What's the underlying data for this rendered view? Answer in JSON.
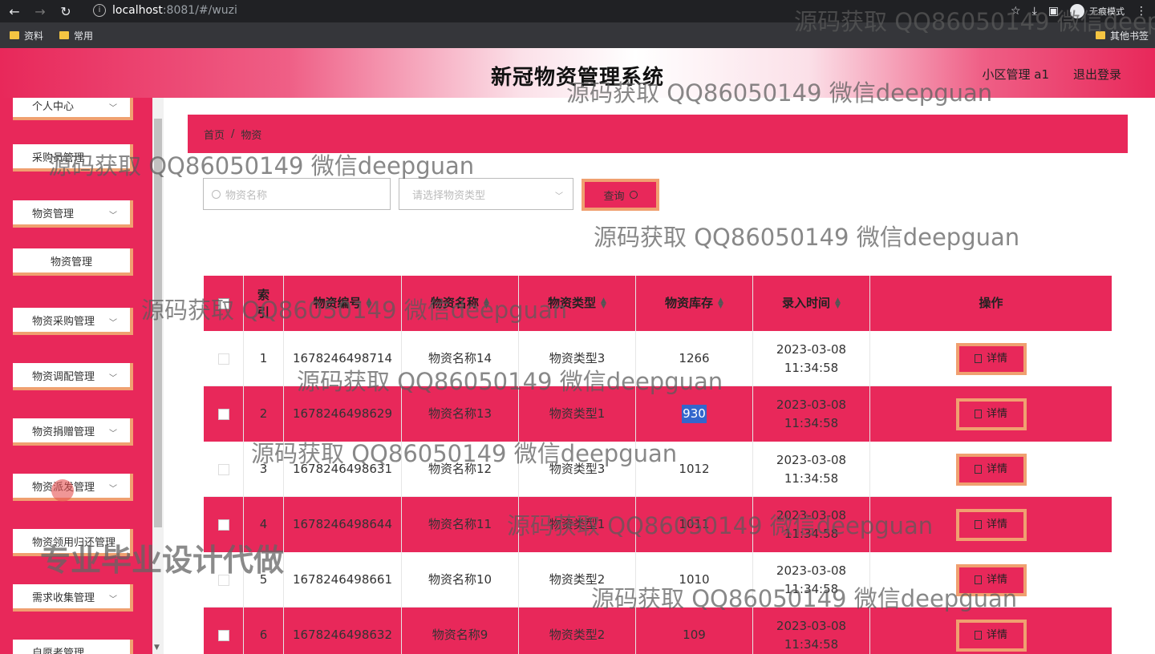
{
  "browser": {
    "url_host": "localhost",
    "url_port_path": ":8081/#/wuzi",
    "incognito_label": "无痕模式",
    "bookmarks": [
      "资料",
      "常用"
    ],
    "other_bookmarks": "其他书签"
  },
  "header": {
    "title": "新冠物资管理系统",
    "user": "小区管理 a1",
    "logout": "退出登录"
  },
  "sidebar": {
    "items": [
      {
        "label": "个人中心"
      },
      {
        "label": "采购员管理"
      },
      {
        "label": "物资管理"
      },
      {
        "label": "物资管理"
      },
      {
        "label": "物资采购管理"
      },
      {
        "label": "物资调配管理"
      },
      {
        "label": "物资捐赠管理"
      },
      {
        "label": "物资派发管理"
      },
      {
        "label": "物资领用归还管理"
      },
      {
        "label": "需求收集管理"
      },
      {
        "label": "自愿者管理"
      }
    ]
  },
  "breadcrumb": {
    "home": "首页",
    "sep": "/",
    "current": "物资"
  },
  "filters": {
    "name_placeholder": "物资名称",
    "type_placeholder": "请选择物资类型",
    "query_label": "查询"
  },
  "table": {
    "headers": [
      "索引",
      "物资编号",
      "物资名称",
      "物资类型",
      "物资库存",
      "录入时间",
      "操作"
    ],
    "detail_label": "详情",
    "rows": [
      {
        "idx": "1",
        "code": "1678246498714",
        "name": "物资名称14",
        "type": "物资类型3",
        "stock": "1266",
        "time": "2023-03-08 11:34:58"
      },
      {
        "idx": "2",
        "code": "1678246498629",
        "name": "物资名称13",
        "type": "物资类型1",
        "stock": "930",
        "time": "2023-03-08 11:34:58"
      },
      {
        "idx": "3",
        "code": "1678246498631",
        "name": "物资名称12",
        "type": "物资类型3",
        "stock": "1012",
        "time": "2023-03-08 11:34:58"
      },
      {
        "idx": "4",
        "code": "1678246498644",
        "name": "物资名称11",
        "type": "物资类型1",
        "stock": "1011",
        "time": "2023-03-08 11:34:58"
      },
      {
        "idx": "5",
        "code": "1678246498661",
        "name": "物资名称10",
        "type": "物资类型2",
        "stock": "1010",
        "time": "2023-03-08 11:34:58"
      },
      {
        "idx": "6",
        "code": "1678246498632",
        "name": "物资名称9",
        "type": "物资类型2",
        "stock": "109",
        "time": "2023-03-08 11:34:58"
      }
    ]
  },
  "watermarks": {
    "text": "源码获取 QQ86050149 微信deepguan",
    "banner": "专业毕业设计代做"
  },
  "colors": {
    "accent": "#e8285a",
    "border_accent": "#f0a070"
  }
}
